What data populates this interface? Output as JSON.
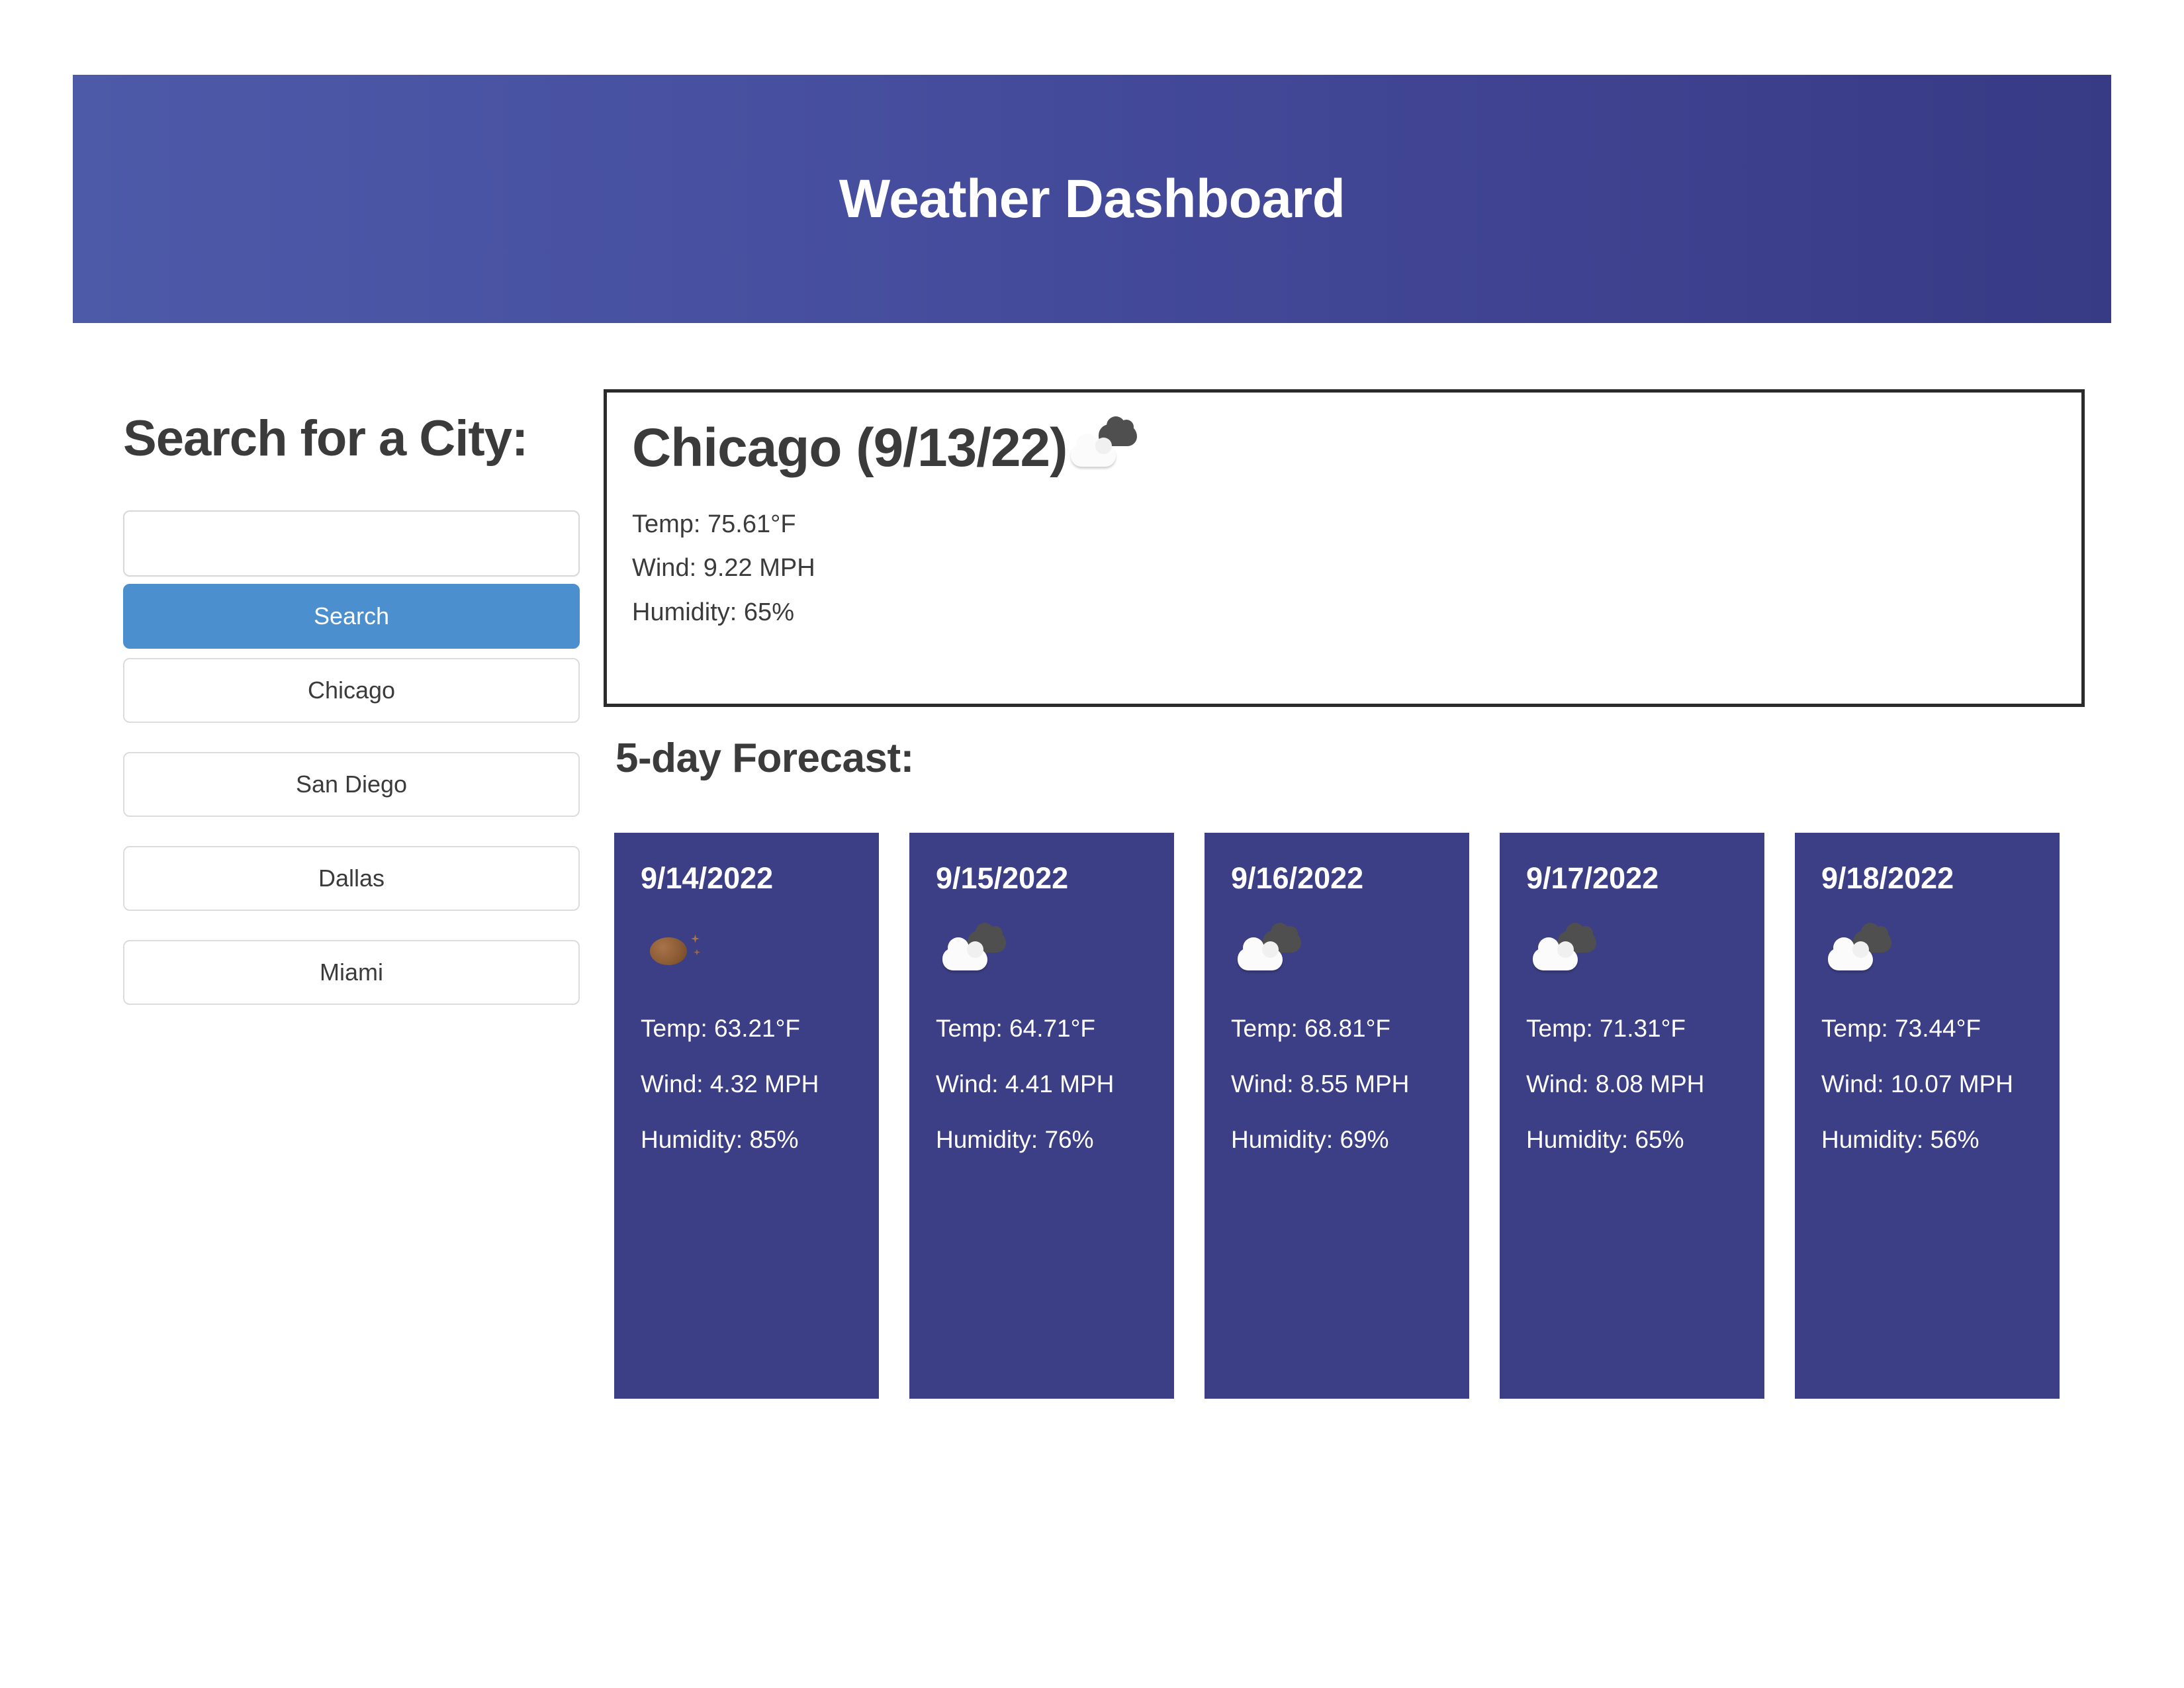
{
  "header": {
    "title": "Weather Dashboard",
    "gradient_start": "#4d5aa8",
    "gradient_end": "#373b86"
  },
  "sidebar": {
    "heading": "Search for a City:",
    "search_input_value": "",
    "search_input_placeholder": "",
    "search_button_label": "Search",
    "history": [
      {
        "label": "Chicago"
      },
      {
        "label": "San Diego"
      },
      {
        "label": "Dallas"
      },
      {
        "label": "Miami"
      }
    ]
  },
  "current": {
    "city_date": "Chicago (9/13/22)",
    "icon": "broken-clouds-icon",
    "temp": "Temp: 75.61°F",
    "wind": "Wind: 9.22 MPH",
    "humidity": "Humidity: 65%"
  },
  "forecast": {
    "heading": "5-day Forecast:",
    "card_color": "#3c3f85",
    "days": [
      {
        "date": "9/14/2022",
        "icon": "night-clear-icon",
        "temp": "Temp: 63.21°F",
        "wind": "Wind: 4.32 MPH",
        "humidity": "Humidity: 85%"
      },
      {
        "date": "9/15/2022",
        "icon": "broken-clouds-icon",
        "temp": "Temp: 64.71°F",
        "wind": "Wind: 4.41 MPH",
        "humidity": "Humidity: 76%"
      },
      {
        "date": "9/16/2022",
        "icon": "broken-clouds-icon",
        "temp": "Temp: 68.81°F",
        "wind": "Wind: 8.55 MPH",
        "humidity": "Humidity: 69%"
      },
      {
        "date": "9/17/2022",
        "icon": "broken-clouds-icon",
        "temp": "Temp: 71.31°F",
        "wind": "Wind: 8.08 MPH",
        "humidity": "Humidity: 65%"
      },
      {
        "date": "9/18/2022",
        "icon": "broken-clouds-icon",
        "temp": "Temp: 73.44°F",
        "wind": "Wind: 10.07 MPH",
        "humidity": "Humidity: 56%"
      }
    ]
  }
}
